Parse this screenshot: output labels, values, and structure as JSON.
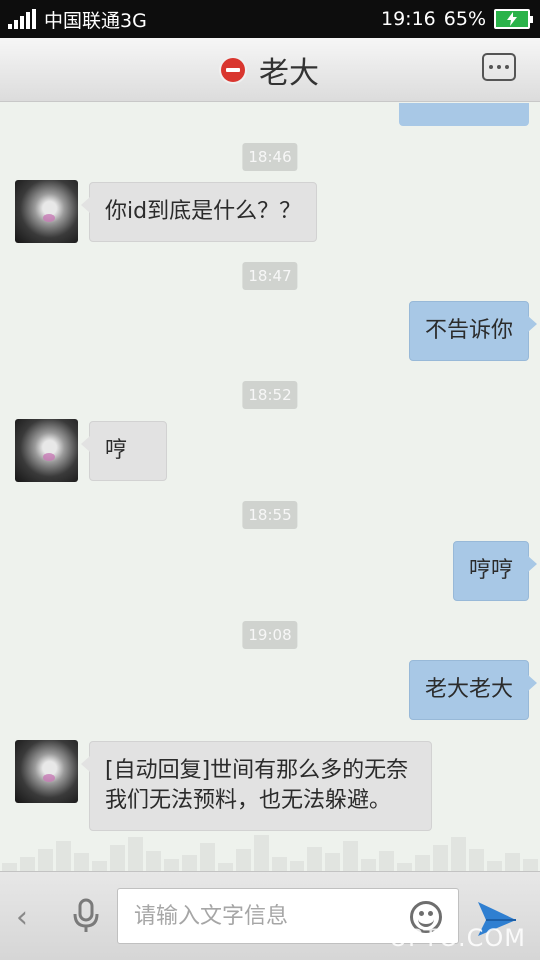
{
  "status_bar": {
    "carrier": "中国联通3G",
    "time": "19:16",
    "battery": "65%"
  },
  "header": {
    "title": "老大",
    "left_icon": "blocked-icon",
    "right_icon": "more-icon"
  },
  "messages": [
    {
      "type": "time",
      "text": "18:46"
    },
    {
      "type": "incoming",
      "text": "你id到底是什么？？"
    },
    {
      "type": "time",
      "text": "18:47"
    },
    {
      "type": "outgoing",
      "text": "不告诉你"
    },
    {
      "type": "time",
      "text": "18:52"
    },
    {
      "type": "incoming",
      "text": "哼"
    },
    {
      "type": "time",
      "text": "18:55"
    },
    {
      "type": "outgoing",
      "text": "哼哼"
    },
    {
      "type": "time",
      "text": "19:08"
    },
    {
      "type": "outgoing",
      "text": "老大老大"
    },
    {
      "type": "incoming",
      "text": "[自动回复]世间有那么多的无奈我们无法预料，也无法躲避。"
    }
  ],
  "input_bar": {
    "placeholder": "请输入文字信息",
    "watermark": "UPTO.COM"
  },
  "colors": {
    "outgoing_bubble": "#a8c8e6",
    "incoming_bubble": "#e2e2e2",
    "chat_background": "#eef2ed",
    "block_icon": "#d9362f",
    "send_icon": "#2f7fd1"
  }
}
